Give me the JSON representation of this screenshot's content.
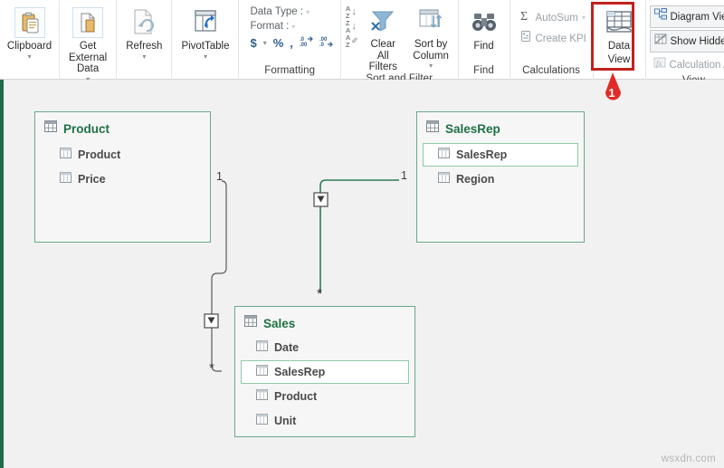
{
  "app": {
    "watermark": "wsxdn.com"
  },
  "ribbon": {
    "groups": [
      {
        "label": "",
        "name": "clipboard-group"
      },
      {
        "label": "",
        "name": "external-data-group"
      },
      {
        "label": "",
        "name": "refresh-group"
      },
      {
        "label": "",
        "name": "pivottable-group"
      },
      {
        "label": "Formatting",
        "name": "formatting-group"
      },
      {
        "label": "Sort and Filter",
        "name": "sort-filter-group"
      },
      {
        "label": "Find",
        "name": "find-group"
      },
      {
        "label": "Calculations",
        "name": "calculations-group"
      },
      {
        "label": "",
        "name": "dataview-group"
      },
      {
        "label": "View",
        "name": "view-group"
      }
    ],
    "clipboard": {
      "label": "Clipboard",
      "icon": "clipboard-icon"
    },
    "get_external_data": {
      "label": "Get External Data",
      "icon": "external-data-icon"
    },
    "refresh": {
      "label": "Refresh",
      "icon": "refresh-icon"
    },
    "pivottable": {
      "label": "PivotTable",
      "icon": "pivottable-icon"
    },
    "formatting": {
      "data_type_label": "Data Type :",
      "data_type_value": "",
      "format_label": "Format :",
      "format_value": "",
      "currency_icon": "$",
      "percent_icon": "%",
      "comma_icon": ",",
      "increase_decimal_icon": ".00",
      "decrease_decimal_icon": ".00",
      "group_label": "Formatting"
    },
    "sort_filter": {
      "sort_asc_icon": "sort-ascending-icon",
      "sort_desc_icon": "sort-descending-icon",
      "clear_sort_icon": "clear-sort-icon",
      "clear_all_filters": "Clear All Filters",
      "sort_by_column": "Sort by Column",
      "group_label": "Sort and Filter"
    },
    "find": {
      "label": "Find",
      "icon": "binoculars-icon",
      "group_label": "Find"
    },
    "calculations": {
      "autosum": "AutoSum",
      "autosum_icon": "sigma-icon",
      "create_kpi": "Create KPI",
      "create_kpi_icon": "kpi-icon",
      "group_label": "Calculations"
    },
    "data_view": {
      "label_line1": "Data",
      "label_line2": "View",
      "icon": "data-view-icon"
    },
    "view": {
      "diagram_view": "Diagram View",
      "diagram_view_icon": "diagram-view-icon",
      "show_hidden": "Show Hidden",
      "show_hidden_icon": "show-hidden-icon",
      "calculation_area": "Calculation Area",
      "calculation_area_icon": "fx-icon",
      "group_label": "View"
    }
  },
  "callouts": [
    {
      "number": "1",
      "color": "#e02b28",
      "target": "data-view-button"
    }
  ],
  "diagram": {
    "tables": [
      {
        "name": "Product",
        "icon": "table-icon",
        "fields": [
          {
            "name": "Product",
            "selected": false
          },
          {
            "name": "Price",
            "selected": false
          }
        ]
      },
      {
        "name": "SalesRep",
        "icon": "table-icon",
        "fields": [
          {
            "name": "SalesRep",
            "selected": true
          },
          {
            "name": "Region",
            "selected": false
          }
        ]
      },
      {
        "name": "Sales",
        "icon": "table-icon",
        "fields": [
          {
            "name": "Date",
            "selected": false
          },
          {
            "name": "SalesRep",
            "selected": true
          },
          {
            "name": "Product",
            "selected": false
          },
          {
            "name": "Unit",
            "selected": false
          }
        ]
      }
    ],
    "relationships": [
      {
        "from": "Product",
        "to": "Sales",
        "from_cardinality": "1",
        "to_cardinality": "*",
        "active": false,
        "color": "#5a5a5a"
      },
      {
        "from": "SalesRep",
        "to": "Sales",
        "from_cardinality": "1",
        "to_cardinality": "*",
        "active": true,
        "color": "#2e7d52"
      }
    ]
  },
  "colors": {
    "table_border": "#6aa98b",
    "table_title": "#1e7145",
    "selection": "#8fcaa9",
    "highlight_red": "#c0221f",
    "canvas_bg": "#f1f1f1",
    "canvas_edge": "#1f6b4a"
  }
}
